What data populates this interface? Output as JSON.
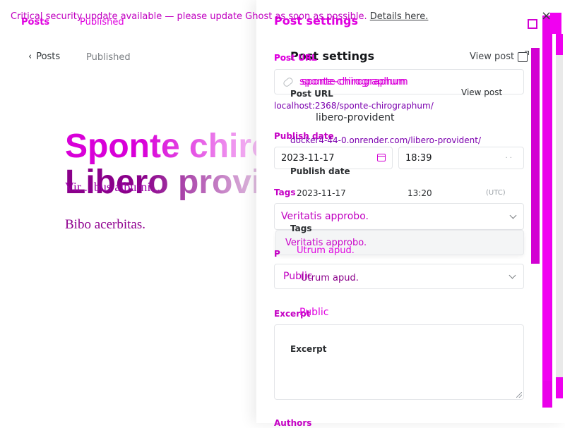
{
  "banner": {
    "message": "Critical security update available — please update Ghost as soon as possible.",
    "link_text": "Details here.",
    "close_label": "×"
  },
  "editor": {
    "back_label": "Posts",
    "status": "Published",
    "title_line1": "Sponte chiro",
    "title_line2": "Libero provid",
    "subtitle": "Vir ...bus alburni...",
    "body": "Bibo acerbitas."
  },
  "panel": {
    "title": "Post settings",
    "view_post_label": "View post",
    "post_url": {
      "label": "Post URL",
      "value": "sponte-chirographum",
      "helper": "localhost:2368/sponte-chirographum/"
    },
    "publish_date": {
      "label": "Publish date",
      "date": "2023-11-17",
      "time": "18:39",
      "tz": "· ·"
    },
    "tags": {
      "label": "Tags",
      "value": "Veritatis approbo.",
      "option": "Veritatis approbo."
    },
    "tier": {
      "label": "P",
      "value": "Public"
    },
    "excerpt": {
      "label": "Excerpt",
      "value": ""
    },
    "authors": {
      "label": "Authors"
    }
  },
  "ghost_overlay": {
    "back_label": "Posts",
    "status": "Published",
    "title": "Post settings",
    "view_post_label": "View post",
    "post_url_label": "Post URL",
    "post_url_value": "sponte-chirographum",
    "url_slug_value": "libero-provident",
    "helper_url": "docker4-44-0.onrender.com/libero-provident/",
    "publish_label": "Publish date",
    "date": "2023-11-17",
    "time": "13:20",
    "tz": "(UTC)",
    "tags_label": "Tags",
    "tag_value": "Utrum apud.",
    "tag_option": "Utrum apud.",
    "visibility": "Public",
    "excerpt_label": "Excerpt"
  },
  "colors": {
    "accent": "#e000e0",
    "dark": "#15171a",
    "border": "#e3e5e8"
  }
}
